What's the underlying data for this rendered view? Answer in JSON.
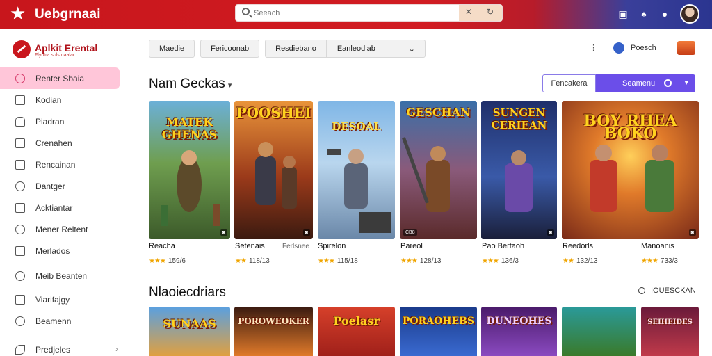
{
  "header": {
    "brand": "Uebgrnaai",
    "search_placeholder": "Seeach",
    "search_btn_icons": [
      "✕",
      "↻"
    ],
    "icons": [
      "bookmark-icon",
      "bell-icon",
      "chat-icon"
    ]
  },
  "sidebar": {
    "brand": "Aplkit Erental",
    "brand_sub": "Flyutra sulsmaalar",
    "items": [
      {
        "label": "Renter Sbaia",
        "icon": "chat-icon",
        "active": true
      },
      {
        "label": "Kodian",
        "icon": "doc-icon"
      },
      {
        "label": "Piadran",
        "icon": "lock-icon"
      },
      {
        "label": "Crenahen",
        "icon": "list-icon"
      },
      {
        "label": "Rencainan",
        "icon": "list-icon"
      },
      {
        "label": "Dantger",
        "icon": "person-icon"
      },
      {
        "label": "Acktiantar",
        "icon": "square-icon"
      },
      {
        "label": "Mener Reltent",
        "icon": "people-icon"
      },
      {
        "label": "Merlados",
        "icon": "grid-icon"
      },
      {
        "label": "Meib Beanten",
        "icon": "circle-icon"
      },
      {
        "label": "Viarifajgy",
        "icon": "check-icon"
      },
      {
        "label": "Beamenn",
        "icon": "clock-icon"
      },
      {
        "label": "Predjeles",
        "icon": "leaf-icon",
        "chevron": "›"
      }
    ]
  },
  "filters": {
    "chips": [
      "Maedie",
      "Fericoonab",
      "Resdiebano"
    ],
    "select": "Eanleodlab",
    "select_caret": "⌄"
  },
  "tools": {
    "dot": "⋮",
    "label": "Poesch"
  },
  "section1": {
    "title": "Nam Geckas",
    "caret": "▾",
    "toggle_left": "Fencakera",
    "toggle_right": "Seamenu"
  },
  "section2": {
    "title": "Nlaoiecdriars",
    "search": "IOUESCKAN"
  },
  "games": [
    {
      "art_title": "MATEK GHENAS",
      "tag": "◙",
      "title": "Reacha",
      "sub": "",
      "rating": "159/6",
      "stars": "★★★"
    },
    {
      "art_title": "POOSHEI",
      "tag": "◙",
      "title": "Setenais",
      "sub": "Ferlsnee",
      "rating": "118/13",
      "stars": "★★"
    },
    {
      "art_title": "DESOAL",
      "tag": "",
      "title": "Spirelon",
      "sub": "",
      "rating": "115/18",
      "stars": "★★★"
    },
    {
      "art_title": "GESCHAN",
      "tag": "CB8",
      "title": "Pareol",
      "sub": "",
      "rating": "128/13",
      "stars": "★★★"
    },
    {
      "art_title": "SUNGEN CERIEAN",
      "tag": "◙",
      "title": "Pao Bertaoh",
      "sub": "",
      "rating": "136/3",
      "stars": "★★★"
    },
    {
      "art_title": "BOY RHEA BOKO",
      "tag": "◙",
      "title": "Reedorls",
      "sub": "Manoanis",
      "rating": "132/13",
      "stars": "★★"
    },
    {
      "art_title": "",
      "tag": "",
      "title": "",
      "sub": "",
      "rating": "733/3",
      "stars": "★★★"
    }
  ],
  "games2": [
    {
      "art_title": "SUNAAS"
    },
    {
      "art_title": "POROWEOKER"
    },
    {
      "art_title": "Poelasr"
    },
    {
      "art_title": "PORAOHEBS"
    },
    {
      "art_title": "DUNEOHES"
    },
    {
      "art_title": ""
    },
    {
      "art_title": "SEIHEIDES"
    }
  ],
  "colors": {
    "brand_red": "#c8161c",
    "accent_purple": "#6b4ee9",
    "active_pink": "#ffc6d9"
  }
}
